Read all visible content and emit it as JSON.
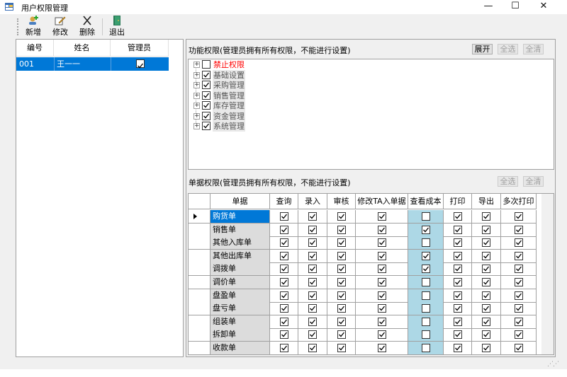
{
  "window": {
    "title": "用户权限管理",
    "minimize": "—",
    "maximize": "☐",
    "close": "✕"
  },
  "toolbar": {
    "items": [
      {
        "label": "新增",
        "icon": "add-user-icon"
      },
      {
        "label": "修改",
        "icon": "edit-icon"
      },
      {
        "label": "删除",
        "icon": "delete-icon"
      },
      {
        "label": "退出",
        "icon": "exit-icon"
      }
    ]
  },
  "users": {
    "columns": [
      "编号",
      "姓名",
      "管理员"
    ],
    "rows": [
      {
        "id": "001",
        "name": "王一一",
        "admin": true
      }
    ]
  },
  "function_perm": {
    "title": "功能权限(管理员拥有所有权限，不能进行设置)",
    "expand_label": "展开",
    "select_all_label": "全选",
    "clear_all_label": "全清",
    "nodes": [
      {
        "label": "禁止权限",
        "checked": false,
        "highlight": "red"
      },
      {
        "label": "基础设置",
        "checked": true
      },
      {
        "label": "采购管理",
        "checked": true
      },
      {
        "label": "销售管理",
        "checked": true
      },
      {
        "label": "库存管理",
        "checked": true
      },
      {
        "label": "资金管理",
        "checked": true
      },
      {
        "label": "系统管理",
        "checked": true
      }
    ]
  },
  "doc_perm": {
    "title": "单据权限(管理员拥有所有权限，不能进行设置)",
    "select_all_label": "全选",
    "clear_all_label": "全清",
    "columns": [
      "单据",
      "查询",
      "录入",
      "审核",
      "修改TA入单据",
      "查看成本",
      "打印",
      "导出",
      "多次打印"
    ],
    "rows": [
      {
        "name": "购货单",
        "checks": [
          true,
          true,
          true,
          true,
          false,
          true,
          true,
          true
        ]
      },
      {
        "name": "销售单",
        "checks": [
          true,
          true,
          true,
          true,
          true,
          true,
          true,
          true
        ]
      },
      {
        "name": "其他入库单",
        "checks": [
          true,
          true,
          true,
          true,
          false,
          true,
          true,
          true
        ]
      },
      {
        "name": "其他出库单",
        "checks": [
          true,
          true,
          true,
          true,
          true,
          true,
          true,
          true
        ]
      },
      {
        "name": "调拨单",
        "checks": [
          true,
          true,
          true,
          true,
          true,
          true,
          true,
          true
        ]
      },
      {
        "name": "调价单",
        "checks": [
          true,
          true,
          true,
          true,
          false,
          true,
          true,
          true
        ]
      },
      {
        "name": "盘盈单",
        "checks": [
          true,
          true,
          true,
          true,
          false,
          true,
          true,
          true
        ]
      },
      {
        "name": "盘亏单",
        "checks": [
          true,
          true,
          true,
          true,
          false,
          true,
          true,
          true
        ]
      },
      {
        "name": "组装单",
        "checks": [
          true,
          true,
          true,
          true,
          false,
          true,
          true,
          true
        ]
      },
      {
        "name": "拆卸单",
        "checks": [
          true,
          true,
          true,
          true,
          false,
          true,
          true,
          true
        ]
      },
      {
        "name": "收款单",
        "checks": [
          true,
          true,
          true,
          true,
          false,
          true,
          true,
          true
        ]
      }
    ]
  }
}
